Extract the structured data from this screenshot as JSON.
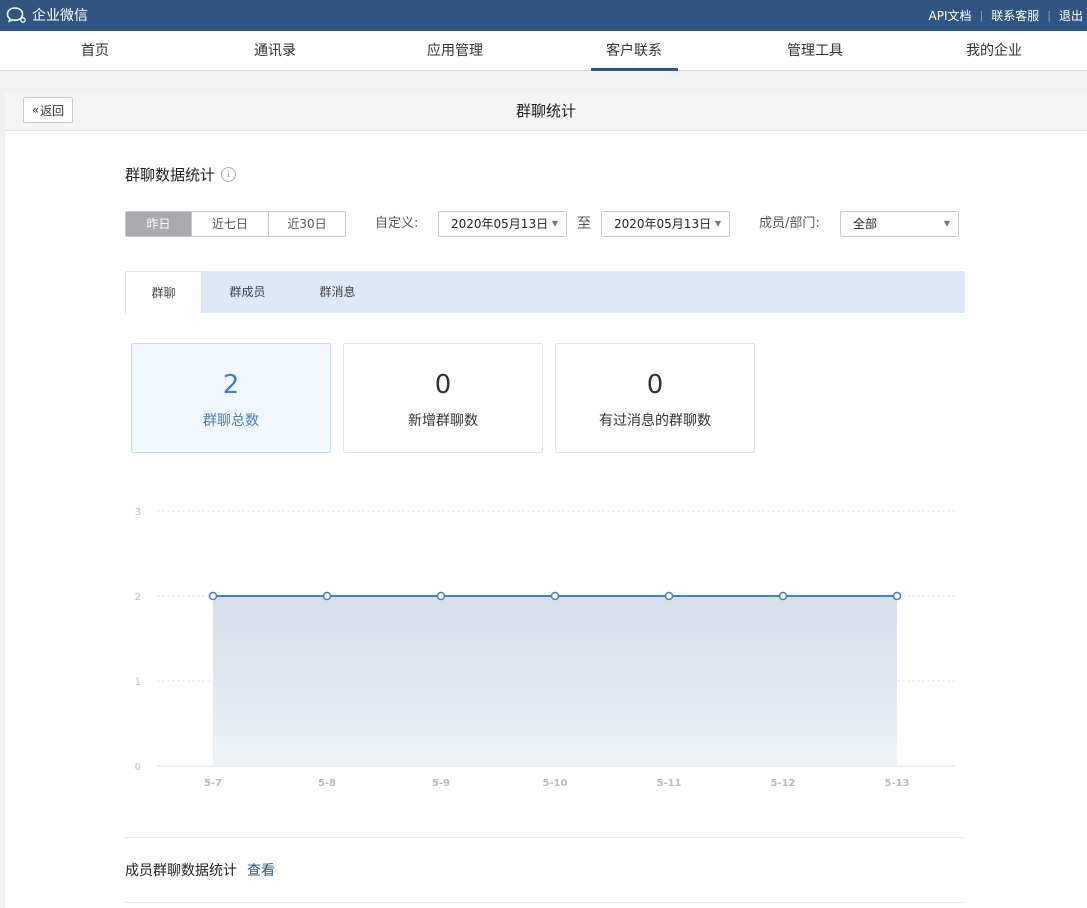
{
  "app": {
    "name": "企业微信"
  },
  "top_links": [
    "API文档",
    "联系客服",
    "退出"
  ],
  "nav": {
    "items": [
      "首页",
      "通讯录",
      "应用管理",
      "客户联系",
      "管理工具",
      "我的企业"
    ],
    "active_index": 3
  },
  "page": {
    "back_label": "返回",
    "title": "群聊统计"
  },
  "stats": {
    "section_title": "群聊数据统计",
    "info_glyph": "i",
    "ranges": [
      "昨日",
      "近七日",
      "近30日"
    ],
    "active_range": 0,
    "custom_label": "自定义:",
    "date_start": "2020年05月13日",
    "to_label": "至",
    "date_end": "2020年05月13日",
    "member_label": "成员/部门:",
    "member_value": "全部"
  },
  "tabs": {
    "items": [
      "群聊",
      "群成员",
      "群消息"
    ],
    "active_index": 0
  },
  "cards": [
    {
      "value": "2",
      "caption": "群聊总数",
      "active": true
    },
    {
      "value": "0",
      "caption": "新增群聊数",
      "active": false
    },
    {
      "value": "0",
      "caption": "有过消息的群聊数",
      "active": false
    }
  ],
  "colors": {
    "brand": "#2f5583",
    "accent": "#4a7eb6",
    "line": "#4a7eb6",
    "tab_bar": "#dde9f8"
  },
  "chart_data": {
    "type": "area",
    "categories": [
      "5-7",
      "5-8",
      "5-9",
      "5-10",
      "5-11",
      "5-12",
      "5-13"
    ],
    "values": [
      2,
      2,
      2,
      2,
      2,
      2,
      2
    ],
    "yticks": [
      0,
      1,
      2,
      3
    ],
    "ylim": [
      0,
      3
    ],
    "grid": true
  },
  "member_stats": {
    "label": "成员群聊数据统计",
    "link": "查看"
  }
}
